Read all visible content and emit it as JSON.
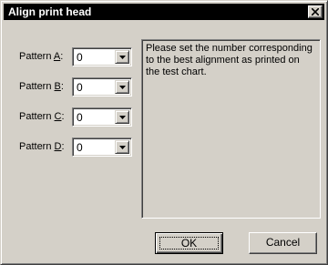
{
  "window": {
    "title": "Align print head",
    "close_icon": "close-icon"
  },
  "patterns": [
    {
      "label_prefix": "Pattern ",
      "mnemonic": "A",
      "label_suffix": ":",
      "value": "0"
    },
    {
      "label_prefix": "Pattern ",
      "mnemonic": "B",
      "label_suffix": ":",
      "value": "0"
    },
    {
      "label_prefix": "Pattern ",
      "mnemonic": "C",
      "label_suffix": ":",
      "value": "0"
    },
    {
      "label_prefix": "Pattern ",
      "mnemonic": "D",
      "label_suffix": ":",
      "value": "0"
    }
  ],
  "info": {
    "text": "Please set the number corresponding to the best alignment as printed on the test chart."
  },
  "buttons": {
    "ok_label": "OK",
    "cancel_label": "Cancel"
  },
  "colors": {
    "face": "#d4d0c8",
    "titlebar": "#000000",
    "title_text": "#ffffff"
  }
}
